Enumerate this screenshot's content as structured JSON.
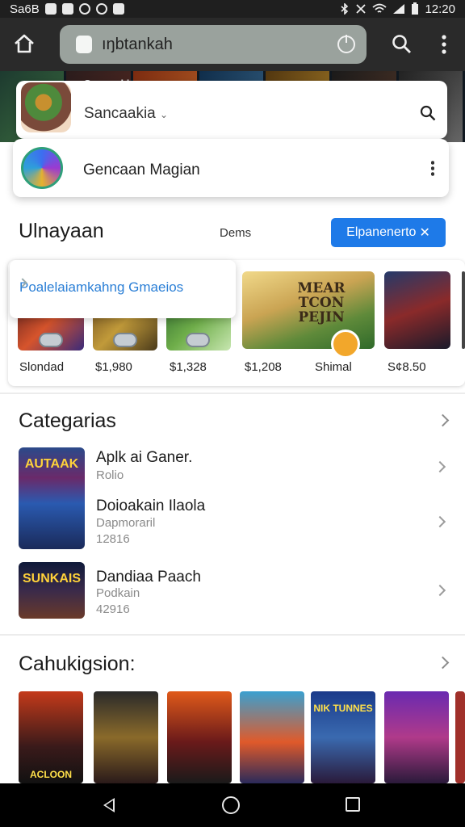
{
  "status_bar": {
    "left_text": "Sa6B",
    "time": "12:20"
  },
  "browser": {
    "url": "ıŋbtankah"
  },
  "banner": {
    "title": "Sancaaki"
  },
  "search_card": {
    "label": "Sancaakia"
  },
  "suggestion": {
    "label": "Gencaan Magian"
  },
  "section1": {
    "title": "Ulnayaan",
    "sub_label": "Dems",
    "button_label": "Elpanenerto",
    "close_glyph": "✕"
  },
  "tooltip": {
    "label": "Poalelaiamkahng Gmaeios"
  },
  "featured_tile": {
    "title": "MEAR TCON PEJIN"
  },
  "games": [
    {
      "price": "Slondad"
    },
    {
      "price": "$1,980"
    },
    {
      "price": "$1,328"
    },
    {
      "price": "$1,208"
    },
    {
      "price": "Shimal"
    },
    {
      "price": "S¢8.50"
    }
  ],
  "categories": {
    "title": "Categarias",
    "items": [
      {
        "name": "Aplk ai Ganer.",
        "sub": "Rolio"
      },
      {
        "name": "Doioakain Ilaola",
        "sub": "Dapmoraril",
        "meta": "12816"
      },
      {
        "name": "Dandiaa Paach",
        "sub": "Podkain",
        "meta": "42916",
        "img_label": "SUNKAIS"
      }
    ],
    "first_img_label": "AUTAAK"
  },
  "section3": {
    "title": "Cahukigsion:",
    "posters": [
      {
        "label": "ACLOON"
      },
      {
        "label": ""
      },
      {
        "label": ""
      },
      {
        "label": ""
      },
      {
        "label": "NIK TUNNES"
      },
      {
        "label": ""
      }
    ]
  },
  "colors": {
    "accent": "#1e7ae8",
    "link": "#2b7fd6",
    "status_bar": "#1f1f1f",
    "browser_bar": "#2a2a2a"
  }
}
